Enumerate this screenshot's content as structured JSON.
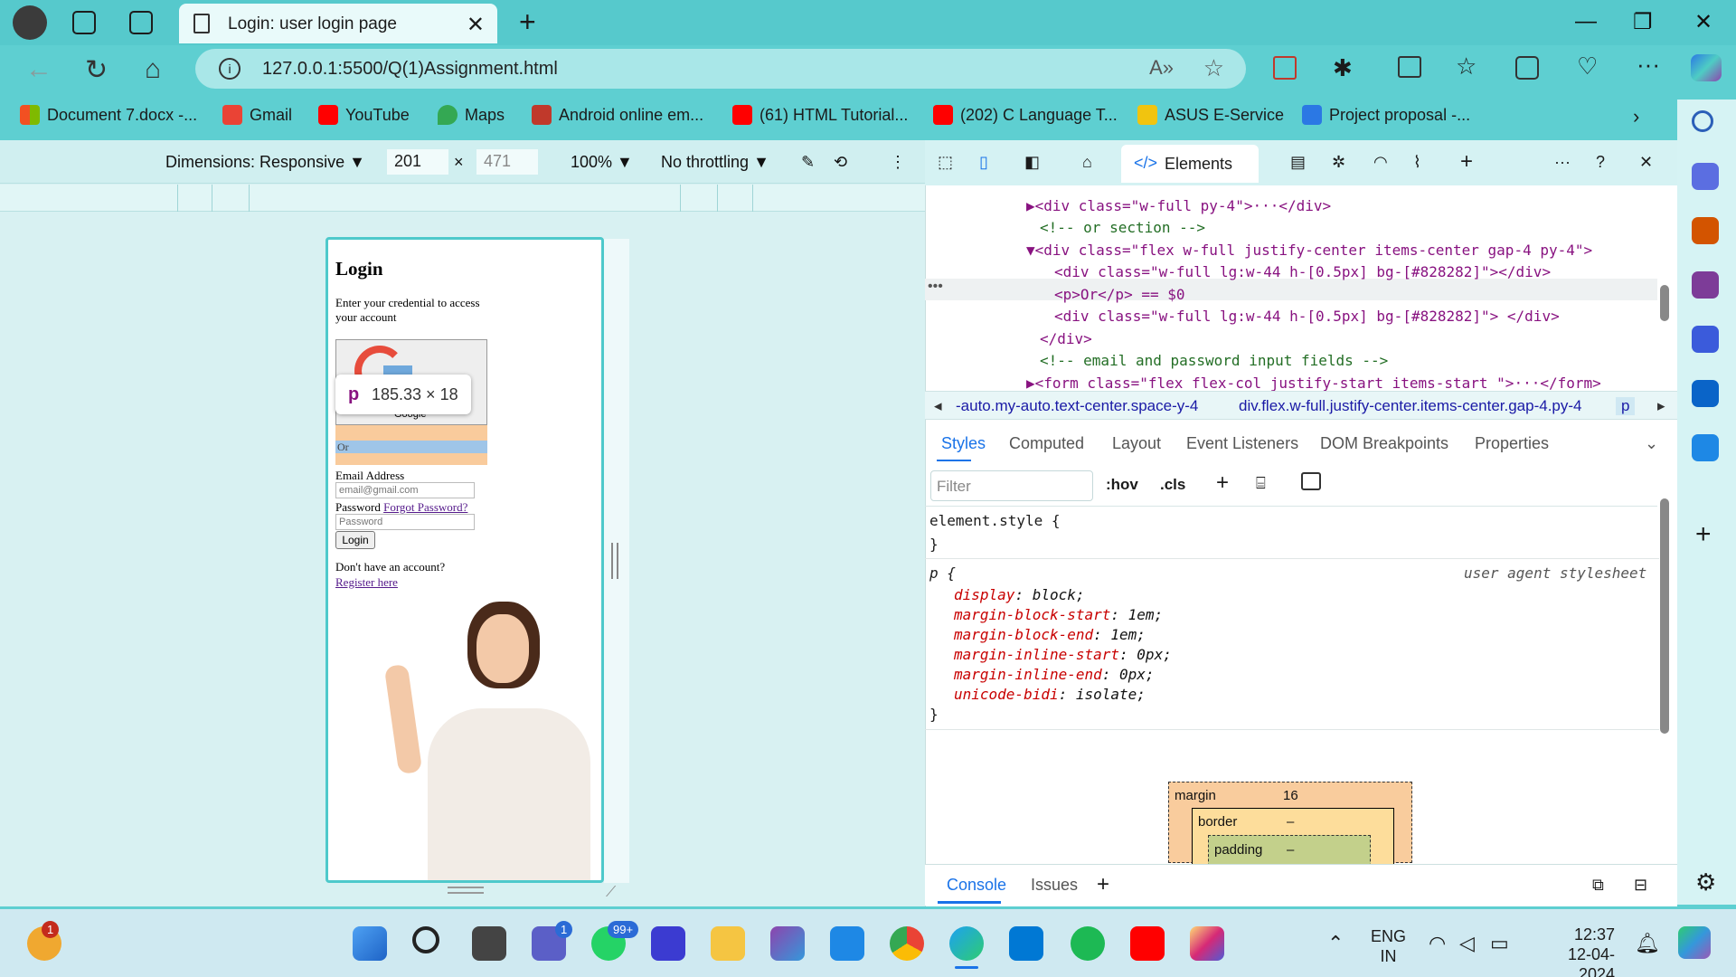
{
  "browser": {
    "tab_title": "Login: user login page",
    "url": "127.0.0.1:5500/Q(1)Assignment.html"
  },
  "bookmarks": [
    {
      "label": "Document 7.docx -...",
      "color": "#e74c3c"
    },
    {
      "label": "Gmail",
      "color": "#ea4335"
    },
    {
      "label": "YouTube",
      "color": "#ff0000"
    },
    {
      "label": "Maps",
      "color": "#34a853"
    },
    {
      "label": "Android online em...",
      "color": "#c0392b"
    },
    {
      "label": "(61) HTML Tutorial...",
      "color": "#ff0000"
    },
    {
      "label": "(202) C Language T...",
      "color": "#ff0000"
    },
    {
      "label": "ASUS E-Service",
      "color": "#f1c40f"
    },
    {
      "label": "Project proposal -...",
      "color": "#2b78e4"
    }
  ],
  "device_toolbar": {
    "dimensions": "Dimensions: Responsive",
    "width": "201",
    "height": "471",
    "zoom": "100%",
    "throttling": "No throttling"
  },
  "page": {
    "title": "Login",
    "subtitle": "Enter your credential to access your account",
    "google_label": "Google",
    "or_text": "Or",
    "email_label": "Email Address",
    "email_placeholder": "email@gmail.com",
    "password_label": "Password",
    "forgot_link": "Forgot Password?",
    "password_placeholder": "Password",
    "login_button": "Login",
    "no_account": "Don't have an account?",
    "register_link": "Register here"
  },
  "tooltip": {
    "tag": "p",
    "size": "185.33 × 18"
  },
  "devtools": {
    "elements_tab": "Elements",
    "dom_lines": [
      "▶<div class=\"w-full py-4\">···</div>",
      "<!-- or section -->",
      "▼<div class=\"flex w-full justify-center items-center gap-4 py-4\">",
      "<div class=\"w-full lg:w-44 h-[0.5px] bg-[#828282]\"></div>",
      "<p>Or</p> == $0",
      "<div class=\"w-full lg:w-44 h-[0.5px] bg-[#828282]\"> </div>",
      "</div>",
      "<!-- email and password input fields -->",
      "▶<form class=\"flex flex-col justify-start items-start \">···</form>"
    ],
    "breadcrumbs": [
      "-auto.my-auto.text-center.space-y-4",
      "div.flex.w-full.justify-center.items-center.gap-4.py-4",
      "p"
    ],
    "subtabs": [
      "Styles",
      "Computed",
      "Layout",
      "Event Listeners",
      "DOM Breakpoints",
      "Properties"
    ],
    "filter_placeholder": "Filter",
    "hov": ":hov",
    "cls": ".cls",
    "element_style": "element.style {",
    "close_brace": "}",
    "p_rule": "p {",
    "ua_label": "user agent stylesheet",
    "declarations": [
      {
        "prop": "display",
        "value": "block;"
      },
      {
        "prop": "margin-block-start",
        "value": "1em;"
      },
      {
        "prop": "margin-block-end",
        "value": "1em;"
      },
      {
        "prop": "margin-inline-start",
        "value": "0px;"
      },
      {
        "prop": "margin-inline-end",
        "value": "0px;"
      },
      {
        "prop": "unicode-bidi",
        "value": "isolate;"
      }
    ],
    "box_model": {
      "margin_label": "margin",
      "margin_value": "16",
      "border_label": "border",
      "border_value": "–",
      "padding_label": "padding",
      "padding_value": "–"
    },
    "drawer_tabs": [
      "Console",
      "Issues"
    ]
  },
  "taskbar": {
    "language": "ENG",
    "region": "IN",
    "time": "12:37",
    "date": "12-04-2024",
    "badge_a": "1",
    "badge_teams": "1",
    "badge_whatsapp": "99+"
  }
}
